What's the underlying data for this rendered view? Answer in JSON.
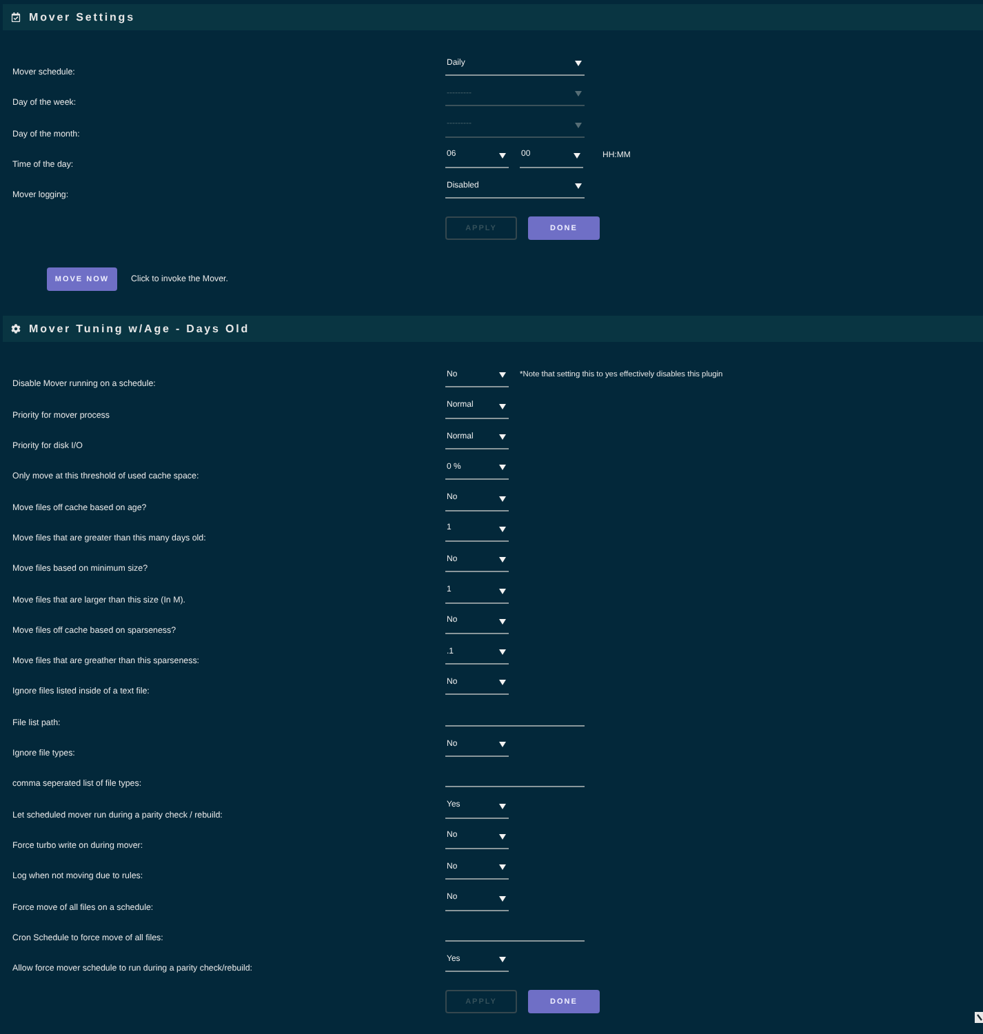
{
  "mover_settings": {
    "title": "Mover Settings",
    "fields": [
      {
        "kind": "select",
        "label": "Mover schedule:",
        "value": "Daily",
        "disabled": false
      },
      {
        "kind": "select",
        "label": "Day of the week:",
        "value": "---------",
        "disabled": true
      },
      {
        "kind": "select",
        "label": "Day of the month:",
        "value": "---------",
        "disabled": true
      },
      {
        "kind": "time",
        "label": "Time of the day:",
        "values": [
          "06",
          "00"
        ],
        "hint": "HH:MM",
        "disabled": false
      },
      {
        "kind": "select",
        "label": "Mover logging:",
        "value": "Disabled",
        "disabled": false
      }
    ],
    "buttons": [
      {
        "label": "APPLY",
        "disabled": true
      },
      {
        "label": "DONE",
        "disabled": false
      }
    ],
    "move_now": {
      "button": "MOVE NOW",
      "text": "Click to invoke the Mover."
    }
  },
  "mover_tuning": {
    "title": "Mover Tuning w/Age - Days Old",
    "fields": [
      {
        "kind": "select",
        "label": "Disable Mover running on a schedule:",
        "value": "No",
        "note": "*Note that setting this to yes effectively disables this plugin"
      },
      {
        "kind": "select",
        "label": "Priority for mover process",
        "value": "Normal"
      },
      {
        "kind": "select",
        "label": "Priority for disk I/O",
        "value": "Normal"
      },
      {
        "kind": "select",
        "label": "Only move at this threshold of used cache space:",
        "value": "0 %"
      },
      {
        "kind": "select",
        "label": "Move files off cache based on age?",
        "value": "No"
      },
      {
        "kind": "select",
        "label": "Move files that are greater than this many days old:",
        "value": "1"
      },
      {
        "kind": "select",
        "label": "Move files based on minimum size?",
        "value": "No"
      },
      {
        "kind": "select",
        "label": "Move files that are larger than this size (In M).",
        "value": "1"
      },
      {
        "kind": "select",
        "label": "Move files off cache based on sparseness?",
        "value": "No"
      },
      {
        "kind": "select",
        "label": "Move files that are greather than this sparseness:",
        "value": ".1"
      },
      {
        "kind": "select",
        "label": "Ignore files listed inside of a text file:",
        "value": "No"
      },
      {
        "kind": "text",
        "label": "File list path:"
      },
      {
        "kind": "select",
        "label": "Ignore file types:",
        "value": "No"
      },
      {
        "kind": "text",
        "label": "comma seperated list of file types:"
      },
      {
        "kind": "select",
        "label": "Let scheduled mover run during a parity check / rebuild:",
        "value": "Yes"
      },
      {
        "kind": "select",
        "label": "Force turbo write on during mover:",
        "value": "No"
      },
      {
        "kind": "select",
        "label": "Log when not moving due to rules:",
        "value": "No"
      },
      {
        "kind": "select",
        "label": "Force move of all files on a schedule:",
        "value": "No"
      },
      {
        "kind": "text",
        "label": "Cron Schedule to force move of all files:"
      },
      {
        "kind": "select",
        "label": "Allow force mover schedule to run during a parity check/rebuild:",
        "value": "Yes"
      }
    ],
    "buttons": [
      {
        "label": "APPLY",
        "disabled": true
      },
      {
        "label": "DONE",
        "disabled": false
      }
    ]
  }
}
